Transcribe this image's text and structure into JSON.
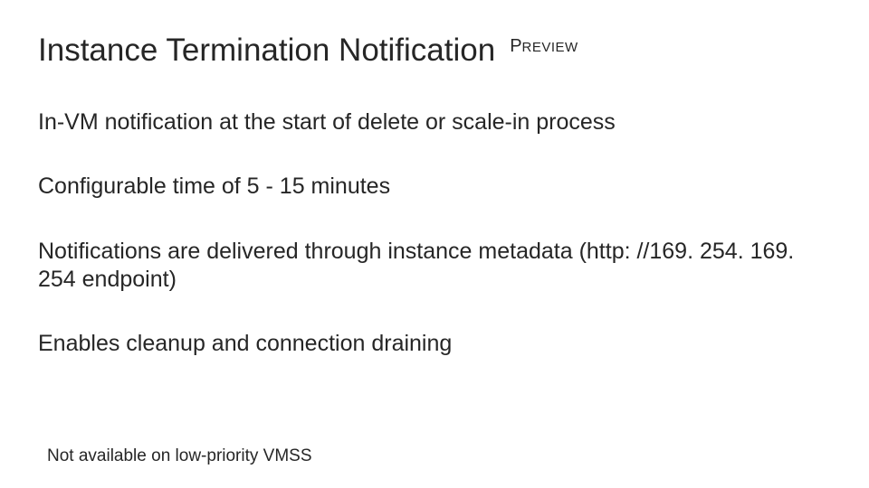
{
  "title": "Instance Termination Notification",
  "badge_first": "P",
  "badge_rest": "REVIEW",
  "lines": [
    "In-VM notification at the start of delete or scale-in process",
    "Configurable time of 5 - 15 minutes",
    "Notifications are delivered through instance metadata (http: //169. 254. 169. 254 endpoint)",
    "Enables cleanup and connection draining"
  ],
  "footnote": "Not available on low-priority VMSS"
}
